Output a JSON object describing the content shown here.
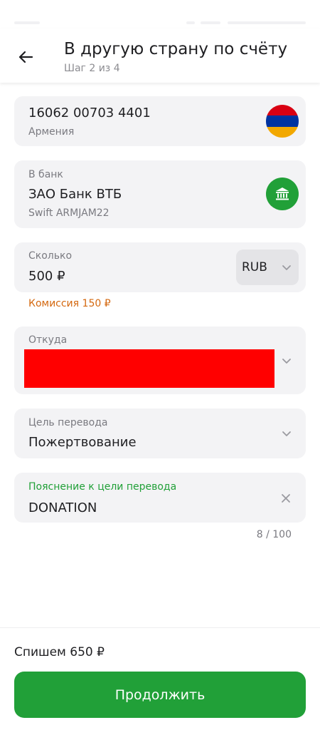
{
  "header": {
    "title": "В другую страну по счёту",
    "step": "Шаг 2 из 4"
  },
  "recipient": {
    "account": "16062 00703 4401",
    "country": "Армения",
    "flag_colors": [
      "#d90012",
      "#0033a0",
      "#f2a800"
    ]
  },
  "bank": {
    "label": "В банк",
    "name": "ЗАО Банк ВТБ",
    "swift": "Swift ARMJAM22",
    "icon": "bank-icon"
  },
  "amount": {
    "label": "Сколько",
    "value": "500 ₽",
    "currency": "RUB",
    "fee": "Комиссия 150 ₽"
  },
  "source": {
    "label": "Откуда"
  },
  "purpose": {
    "label": "Цель перевода",
    "value": "Пожертвование"
  },
  "explanation": {
    "label": "Пояснение к цели перевода",
    "value": "DONATION",
    "counter": "8 / 100"
  },
  "footer": {
    "debit": "Спишем 650 ₽",
    "continue_label": "Продолжить"
  },
  "colors": {
    "accent_green": "#21a038",
    "fee_orange": "#d4680f",
    "redaction": "#ff0000"
  }
}
